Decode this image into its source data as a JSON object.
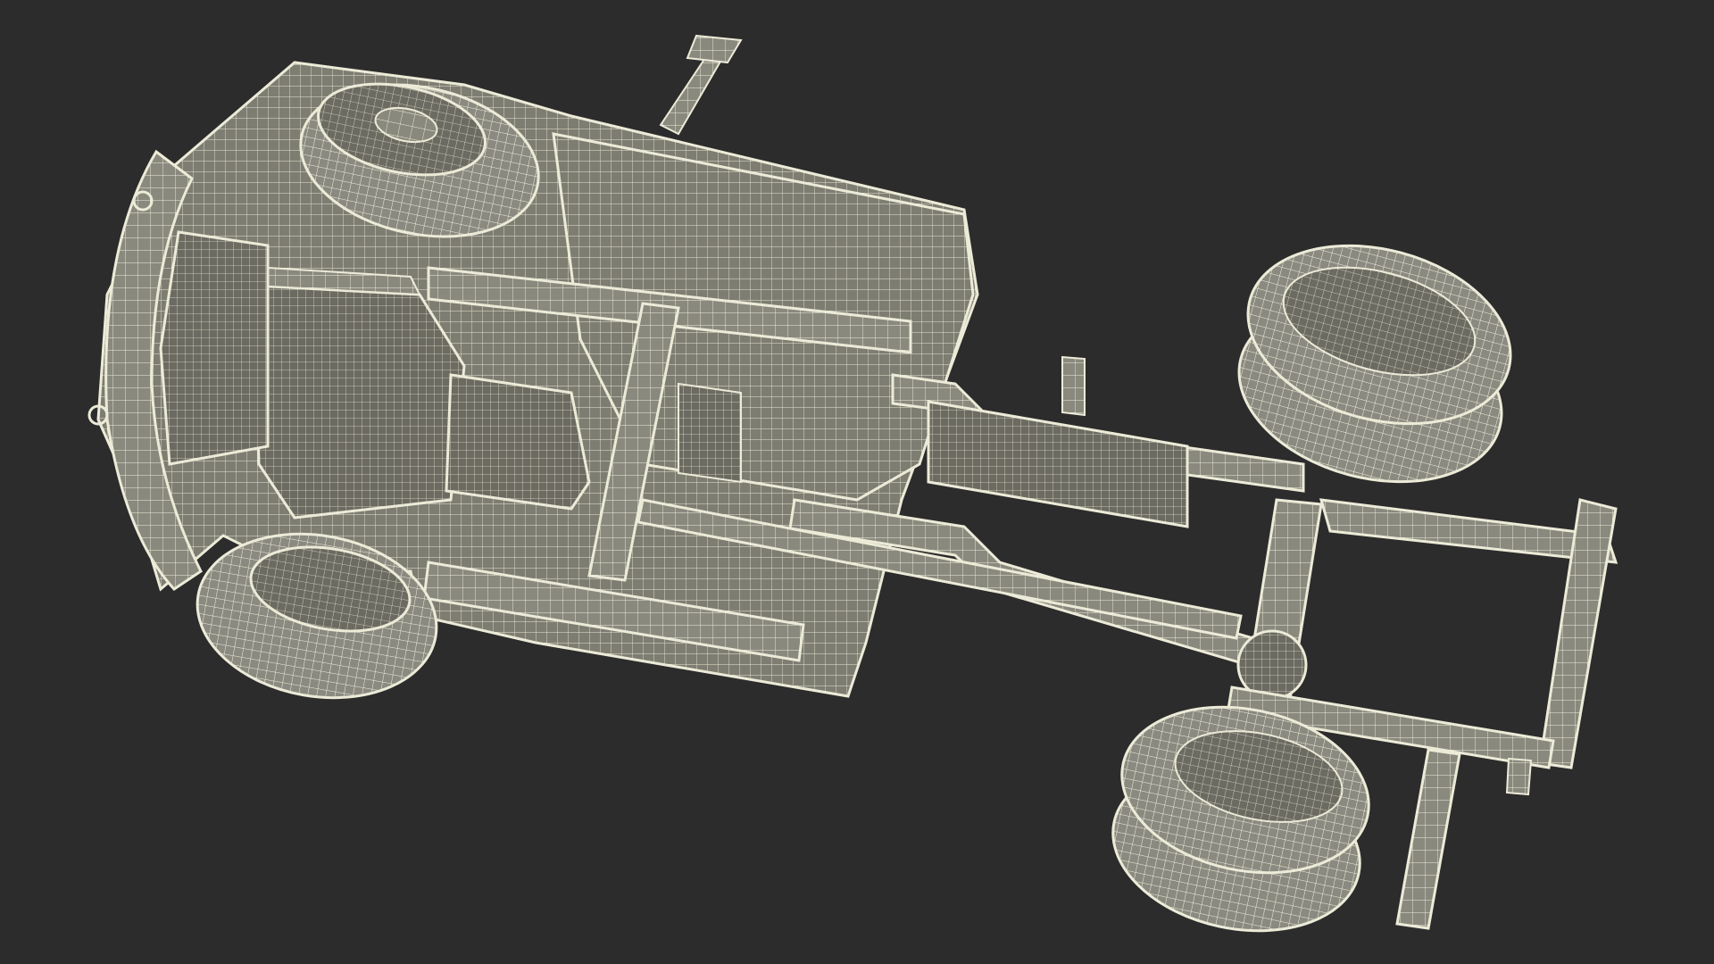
{
  "scene": {
    "subject": "truck-chassis-wireframe-underside",
    "render_mode": "wireframe-on-solid",
    "colors": {
      "background": "#2c2c2c",
      "surface": "#7e7d72",
      "surface_light": "#96958a",
      "surface_dark": "#5e5d55",
      "wire": "#ecebd8",
      "wire_dim": "#c9c8b5"
    }
  }
}
